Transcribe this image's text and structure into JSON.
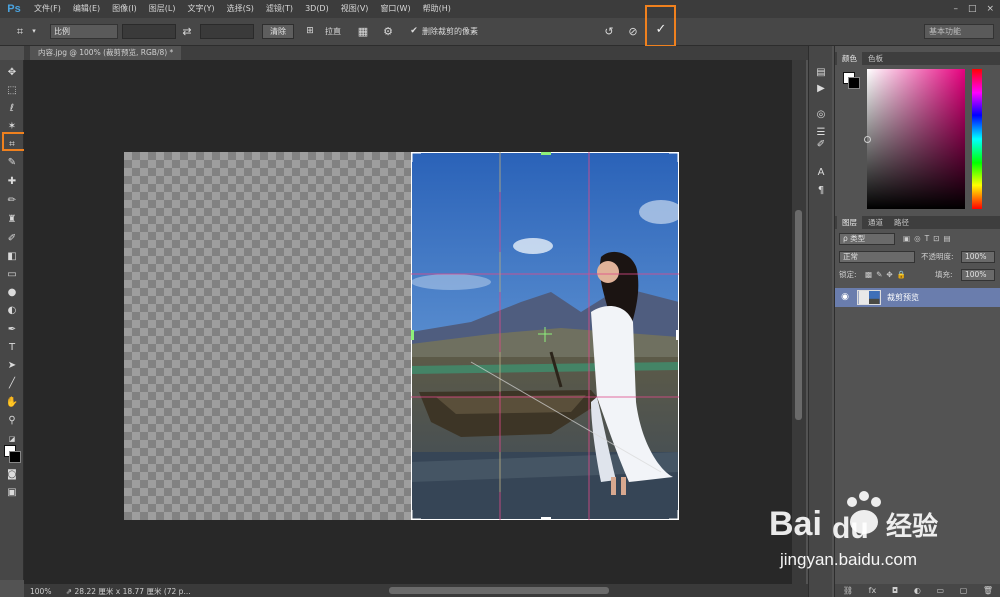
{
  "app": {
    "logo": "Ps"
  },
  "menu": [
    "文件(F)",
    "编辑(E)",
    "图像(I)",
    "图层(L)",
    "文字(Y)",
    "选择(S)",
    "滤镜(T)",
    "3D(D)",
    "视图(V)",
    "窗口(W)",
    "帮助(H)"
  ],
  "window_controls": [
    "–",
    "□",
    "×"
  ],
  "options": {
    "ratio_label": "比例",
    "clear_label": "清除",
    "straighten_label": "拉直",
    "delete_cropped_label": "删除裁剪的像素",
    "delete_cropped_checked": true,
    "workspace_label": "基本功能"
  },
  "document": {
    "tab_title": "内容.jpg @ 100% (裁剪预览, RGB/8) *",
    "zoom": "100%",
    "size_info": "28.22 厘米 x 18.77 厘米 (72 p..."
  },
  "panels": {
    "color_tabs": [
      "颜色",
      "色板"
    ],
    "layers_tabs": [
      "图层",
      "通道",
      "路径"
    ],
    "filter_kind": "ρ 类型",
    "blend_mode": "正常",
    "opacity_label": "不透明度:",
    "opacity_value": "100%",
    "lock_label": "锁定:",
    "fill_label": "填充:",
    "fill_value": "100%",
    "layer_name": "裁剪预览"
  },
  "watermark": {
    "text": "jingyan.baidu.com"
  },
  "colors": {
    "accent": "#f0811e",
    "layer_selected": "#6a7dad",
    "canvas_bg": "#282828"
  }
}
